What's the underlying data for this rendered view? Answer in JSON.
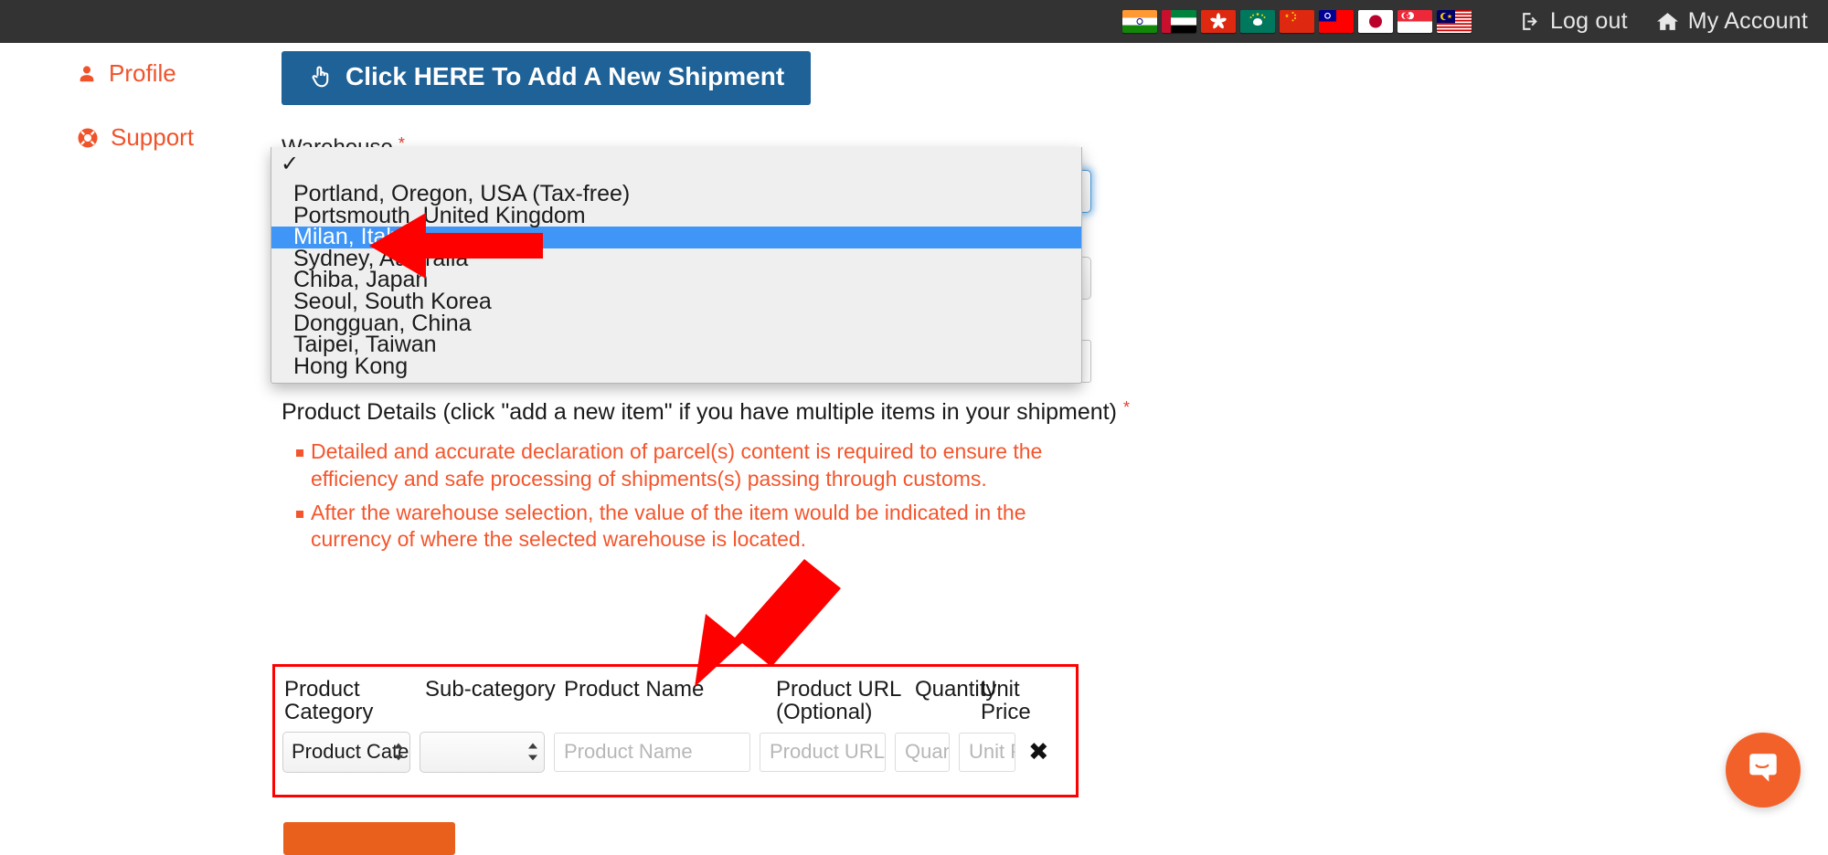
{
  "topbar": {
    "flags": [
      {
        "name": "flag-india",
        "label": "India"
      },
      {
        "name": "flag-uae",
        "label": "United Arab Emirates"
      },
      {
        "name": "flag-hong-kong",
        "label": "Hong Kong"
      },
      {
        "name": "flag-macau",
        "label": "Macau"
      },
      {
        "name": "flag-china",
        "label": "China"
      },
      {
        "name": "flag-taiwan",
        "label": "Taiwan"
      },
      {
        "name": "flag-japan",
        "label": "Japan"
      },
      {
        "name": "flag-singapore",
        "label": "Singapore"
      },
      {
        "name": "flag-malaysia",
        "label": "Malaysia"
      }
    ],
    "logout_label": "Log out",
    "logout_icon": "sign-out-icon",
    "account_label": "My Account",
    "account_icon": "home-icon",
    "background": "#333333"
  },
  "sidebar": {
    "items": [
      {
        "label": "Profile",
        "icon": "user-icon"
      },
      {
        "label": "Support",
        "icon": "life-ring-icon"
      }
    ],
    "color": "#f0532a"
  },
  "main": {
    "add_shipment_button": {
      "label": "Click HERE To Add A New Shipment",
      "icon": "hand-pointer-icon",
      "color": "#1f6298"
    },
    "warehouse": {
      "label": "Warehouse",
      "required_marker": "*",
      "selected_value": "",
      "dropdown_open": true,
      "options": [
        {
          "label": "",
          "checked": true
        },
        {
          "label": "Portland, Oregon, USA (Tax-free)",
          "checked": false
        },
        {
          "label": "Portsmouth, United Kingdom",
          "checked": false
        },
        {
          "label": "Milan, Italy",
          "checked": false,
          "highlighted": true
        },
        {
          "label": "Sydney, Australia",
          "checked": false
        },
        {
          "label": "Chiba, Japan",
          "checked": false
        },
        {
          "label": "Seoul, South Korea",
          "checked": false
        },
        {
          "label": "Dongguan, China",
          "checked": false
        },
        {
          "label": "Taipei, Taiwan",
          "checked": false
        },
        {
          "label": "Hong Kong",
          "checked": false
        }
      ],
      "check_glyph": "✓",
      "highlight_color": "#3f96f6"
    },
    "product_details": {
      "title": "Product Details (click \"add a new item\" if you have multiple items in your shipment)",
      "required_marker": "*",
      "notes": [
        "Detailed and accurate declaration of parcel(s) content is required to ensure the efficiency and safe processing of shipments(s) passing through customs.",
        "After the warehouse selection, the value of the item would be indicated in the currency of where the selected warehouse is located."
      ],
      "notes_color": "#f4552c"
    },
    "product_table": {
      "border_color": "#ff0000",
      "headers": [
        "Product Category",
        "Sub-category",
        "Product Name",
        "Product URL (Optional)",
        "Quantity",
        "Unit Price"
      ],
      "row": {
        "category_value": "Product Cate",
        "subcategory_value": "",
        "product_name_placeholder": "Product Name",
        "product_url_placeholder": "Product URL",
        "quantity_placeholder": "Quan",
        "unit_price_placeholder": "Unit P",
        "remove_glyph": "✖"
      }
    },
    "submit_button": {
      "label": "",
      "color": "#e8601c"
    }
  },
  "chat": {
    "icon": "intercom-chat-icon",
    "color": "#f2612a"
  },
  "annotations": {
    "arrow_color": "#ff0000",
    "arrow_milan": "points-to-milan-italy-option",
    "arrow_table": "points-to-product-details-table"
  }
}
